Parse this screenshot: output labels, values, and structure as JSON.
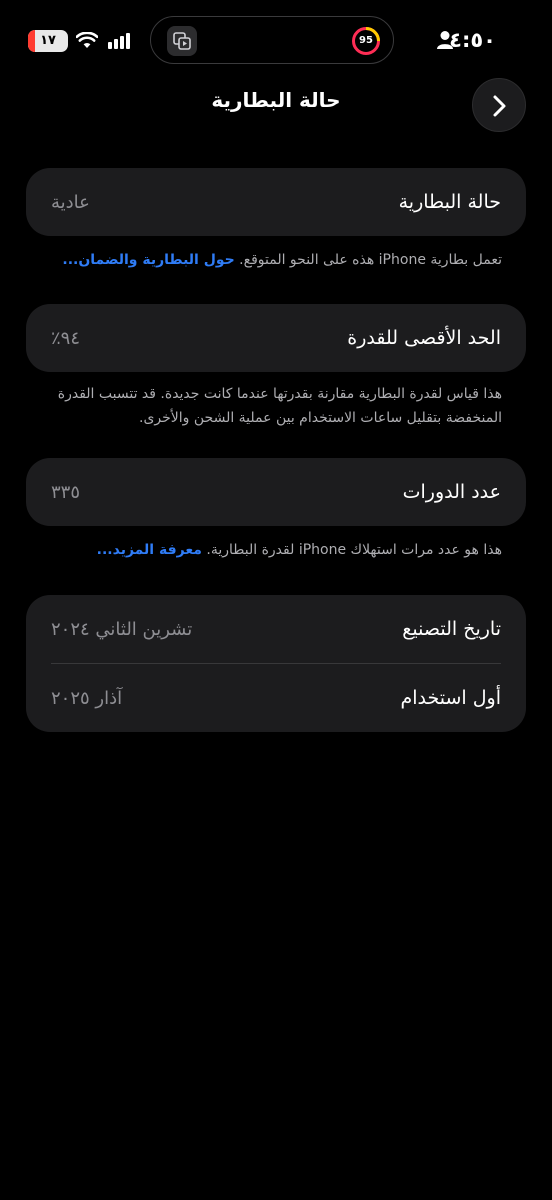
{
  "status_bar": {
    "time": "٤:٥٠",
    "battery_text": "١٧",
    "battery_level": 0.17,
    "ring_value": "95",
    "colors": {
      "battery_low": "#ff3b30"
    },
    "icons": [
      "person-icon",
      "signal-icon",
      "wifi-icon",
      "battery-icon",
      "app-icon",
      "activity-ring-icon"
    ]
  },
  "nav": {
    "title": "حالة البطارية",
    "back_icon": "chevron-right-icon"
  },
  "battery_health": {
    "label": "حالة البطارية",
    "value": "عادية",
    "footnote": "تعمل بطارية iPhone هذه على النحو المتوقع. ",
    "link": "حول البطارية والضمان..."
  },
  "max_capacity": {
    "label": "الحد الأقصى للقدرة",
    "value": "٩٤٪",
    "footnote": "هذا قياس لقدرة البطارية مقارنة بقدرتها عندما كانت جديدة. قد تتسبب القدرة المنخفضة بتقليل ساعات الاستخدام بين عملية الشحن والأخرى."
  },
  "cycle_count": {
    "label": "عدد الدورات",
    "value": "٣٣٥",
    "footnote": "هذا هو عدد مرات استهلاك iPhone لقدرة البطارية. ",
    "link": "معرفة المزيد..."
  },
  "dates": {
    "manufacture_label": "تاريخ التصنيع",
    "manufacture_value": "تشرين الثاني ٢٠٢٤",
    "first_use_label": "أول استخدام",
    "first_use_value": "آذار ٢٠٢٥"
  },
  "colors": {
    "background": "#000000",
    "card": "#1c1c1e",
    "link": "#2f7cf6",
    "secondary_text": "#8e8e93"
  }
}
